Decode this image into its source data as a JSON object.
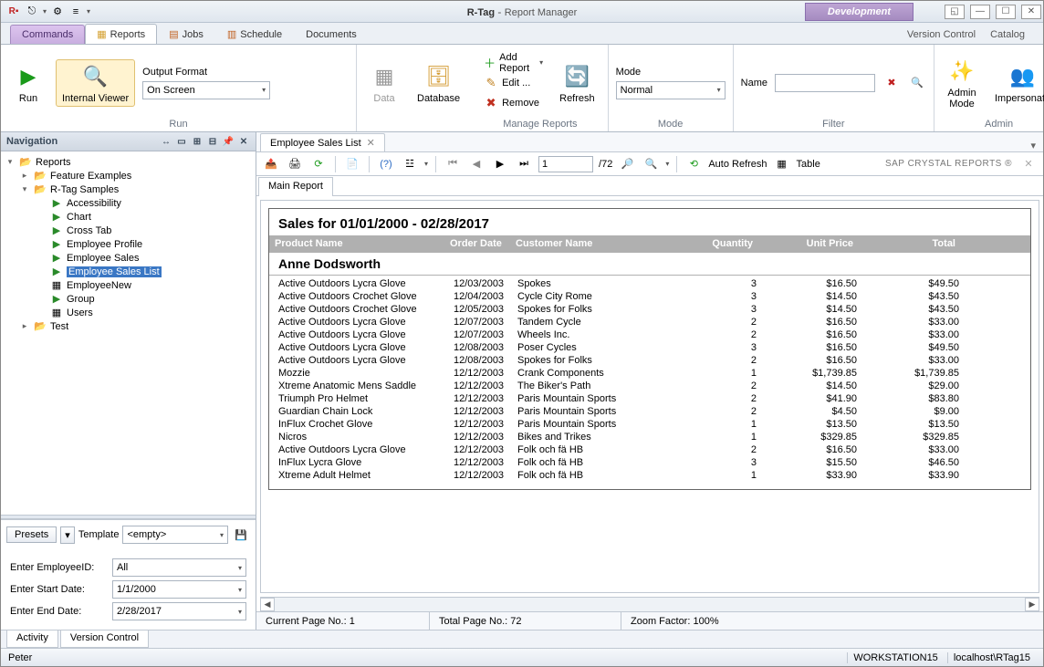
{
  "app": {
    "product": "R-Tag",
    "module": "Report Manager",
    "devBadge": "Development"
  },
  "winButtons": {
    "restore": "◱",
    "min": "—",
    "max": "☐",
    "close": "✕"
  },
  "quickAccess": [
    "Rx",
    "⎋",
    "⚙",
    "≡"
  ],
  "mainTabs": {
    "commands": "Commands",
    "reports": "Reports",
    "jobs": "Jobs",
    "schedule": "Schedule",
    "documents": "Documents",
    "versionControl": "Version Control",
    "catalog": "Catalog"
  },
  "ribbon": {
    "run": {
      "runLabel": "Run",
      "viewerLabel": "Internal Viewer",
      "outputLabel": "Output Format",
      "outputValue": "On Screen",
      "caption": "Run"
    },
    "data": {
      "dataLabel": "Data",
      "dbLabel": "Database"
    },
    "manage": {
      "add": "Add Report",
      "edit": "Edit ...",
      "remove": "Remove",
      "refresh": "Refresh",
      "caption": "Manage Reports"
    },
    "mode": {
      "label": "Mode",
      "value": "Normal",
      "caption": "Mode"
    },
    "filter": {
      "label": "Name",
      "value": "",
      "caption": "Filter"
    },
    "admin": {
      "adminMode": "Admin Mode",
      "impersonate": "Impersonate",
      "caption": "Admin"
    }
  },
  "nav": {
    "title": "Navigation",
    "tree": [
      {
        "lvl": 0,
        "exp": "▾",
        "icon": "📂",
        "cls": "folder",
        "label": "Reports"
      },
      {
        "lvl": 1,
        "exp": "▸",
        "icon": "📂",
        "cls": "folder",
        "label": "Feature Examples"
      },
      {
        "lvl": 1,
        "exp": "▾",
        "icon": "📂",
        "cls": "folder",
        "label": "R-Tag Samples"
      },
      {
        "lvl": 2,
        "exp": "",
        "icon": "▶",
        "cls": "rep",
        "label": "Accessibility"
      },
      {
        "lvl": 2,
        "exp": "",
        "icon": "▶",
        "cls": "rep",
        "label": "Chart"
      },
      {
        "lvl": 2,
        "exp": "",
        "icon": "▶",
        "cls": "rep",
        "label": "Cross Tab"
      },
      {
        "lvl": 2,
        "exp": "",
        "icon": "▶",
        "cls": "rep",
        "label": "Employee  Profile"
      },
      {
        "lvl": 2,
        "exp": "",
        "icon": "▶",
        "cls": "rep",
        "label": "Employee  Sales"
      },
      {
        "lvl": 2,
        "exp": "",
        "icon": "▶",
        "cls": "rep",
        "label": "Employee Sales List",
        "sel": true
      },
      {
        "lvl": 2,
        "exp": "",
        "icon": "▦",
        "cls": "",
        "label": "EmployeeNew"
      },
      {
        "lvl": 2,
        "exp": "",
        "icon": "▶",
        "cls": "rep",
        "label": "Group"
      },
      {
        "lvl": 2,
        "exp": "",
        "icon": "▦",
        "cls": "",
        "label": "Users"
      },
      {
        "lvl": 1,
        "exp": "▸",
        "icon": "📂",
        "cls": "folder",
        "label": "Test"
      }
    ],
    "presets": {
      "btn": "Presets",
      "tplLabel": "Template",
      "tplValue": "<empty>"
    },
    "params": {
      "rows": [
        {
          "label": "Enter EmployeeID:",
          "value": "All"
        },
        {
          "label": "Enter Start Date:",
          "value": "1/1/2000"
        },
        {
          "label": "Enter End Date:",
          "value": "2/28/2017"
        }
      ]
    }
  },
  "doc": {
    "tabLabel": "Employee Sales List",
    "pageInput": "1",
    "pageTotal": "/72",
    "autoRefresh": "Auto Refresh",
    "tableBtn": "Table",
    "brand": "SAP CRYSTAL REPORTS ®",
    "subTab": "Main Report"
  },
  "report": {
    "title": "Sales for 01/01/2000 - 02/28/2017",
    "columns": [
      "Product Name",
      "Order Date",
      "Customer Name",
      "Quantity",
      "Unit Price",
      "Total"
    ],
    "group": "Anne Dodsworth",
    "rows": [
      {
        "p": "Active Outdoors Lycra Glove",
        "d": "12/03/2003",
        "c": "Spokes",
        "q": "3",
        "u": "$16.50",
        "t": "$49.50"
      },
      {
        "p": "Active Outdoors Crochet Glove",
        "d": "12/04/2003",
        "c": "Cycle City Rome",
        "q": "3",
        "u": "$14.50",
        "t": "$43.50"
      },
      {
        "p": "Active Outdoors Crochet Glove",
        "d": "12/05/2003",
        "c": "Spokes for Folks",
        "q": "3",
        "u": "$14.50",
        "t": "$43.50"
      },
      {
        "p": "Active Outdoors Lycra Glove",
        "d": "12/07/2003",
        "c": "Tandem Cycle",
        "q": "2",
        "u": "$16.50",
        "t": "$33.00"
      },
      {
        "p": "Active Outdoors Lycra Glove",
        "d": "12/07/2003",
        "c": "Wheels Inc.",
        "q": "2",
        "u": "$16.50",
        "t": "$33.00"
      },
      {
        "p": "Active Outdoors Lycra Glove",
        "d": "12/08/2003",
        "c": "Poser Cycles",
        "q": "3",
        "u": "$16.50",
        "t": "$49.50"
      },
      {
        "p": "Active Outdoors Lycra Glove",
        "d": "12/08/2003",
        "c": "Spokes for Folks",
        "q": "2",
        "u": "$16.50",
        "t": "$33.00"
      },
      {
        "p": "Mozzie",
        "d": "12/12/2003",
        "c": "Crank Components",
        "q": "1",
        "u": "$1,739.85",
        "t": "$1,739.85"
      },
      {
        "p": "Xtreme Anatomic Mens Saddle",
        "d": "12/12/2003",
        "c": "The Biker's Path",
        "q": "2",
        "u": "$14.50",
        "t": "$29.00"
      },
      {
        "p": "Triumph Pro Helmet",
        "d": "12/12/2003",
        "c": "Paris Mountain Sports",
        "q": "2",
        "u": "$41.90",
        "t": "$83.80"
      },
      {
        "p": "Guardian Chain Lock",
        "d": "12/12/2003",
        "c": "Paris Mountain Sports",
        "q": "2",
        "u": "$4.50",
        "t": "$9.00"
      },
      {
        "p": "InFlux Crochet Glove",
        "d": "12/12/2003",
        "c": "Paris Mountain Sports",
        "q": "1",
        "u": "$13.50",
        "t": "$13.50"
      },
      {
        "p": "Nicros",
        "d": "12/12/2003",
        "c": "Bikes and Trikes",
        "q": "1",
        "u": "$329.85",
        "t": "$329.85"
      },
      {
        "p": "Active Outdoors Lycra Glove",
        "d": "12/12/2003",
        "c": "Folk och fä HB",
        "q": "2",
        "u": "$16.50",
        "t": "$33.00"
      },
      {
        "p": "InFlux Lycra Glove",
        "d": "12/12/2003",
        "c": "Folk och fä HB",
        "q": "3",
        "u": "$15.50",
        "t": "$46.50"
      },
      {
        "p": "Xtreme Adult Helmet",
        "d": "12/12/2003",
        "c": "Folk och fä HB",
        "q": "1",
        "u": "$33.90",
        "t": "$33.90"
      }
    ]
  },
  "viewerStatus": {
    "page": "Current Page No.: 1",
    "total": "Total Page No.: 72",
    "zoom": "Zoom Factor: 100%"
  },
  "bottomTabs": {
    "activity": "Activity",
    "versionControl": "Version Control"
  },
  "status": {
    "user": "Peter",
    "ws": "WORKSTATION15",
    "db": "localhost\\RTag15"
  }
}
